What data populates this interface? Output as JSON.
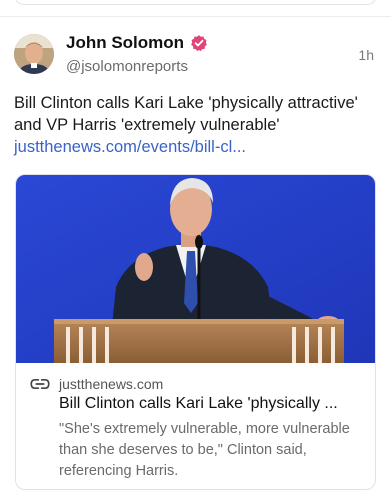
{
  "post": {
    "author_name": "John Solomon",
    "author_handle": "@jsolomonreports",
    "time": "1h",
    "text": "Bill Clinton calls Kari Lake 'physically attractive' and VP Harris 'extremely vulnerable' ",
    "link_text": "justthenews.com/events/bill-cl...",
    "verified_color": "#e0457a"
  },
  "link_card": {
    "domain": "justthenews.com",
    "title": "Bill Clinton calls Kari Lake 'physically ...",
    "description": "\"She's extremely vulnerable, more vulnerable than she deserves to be,\" Clinton said, referencing Harris.",
    "icons": {
      "link": "link-icon"
    }
  }
}
